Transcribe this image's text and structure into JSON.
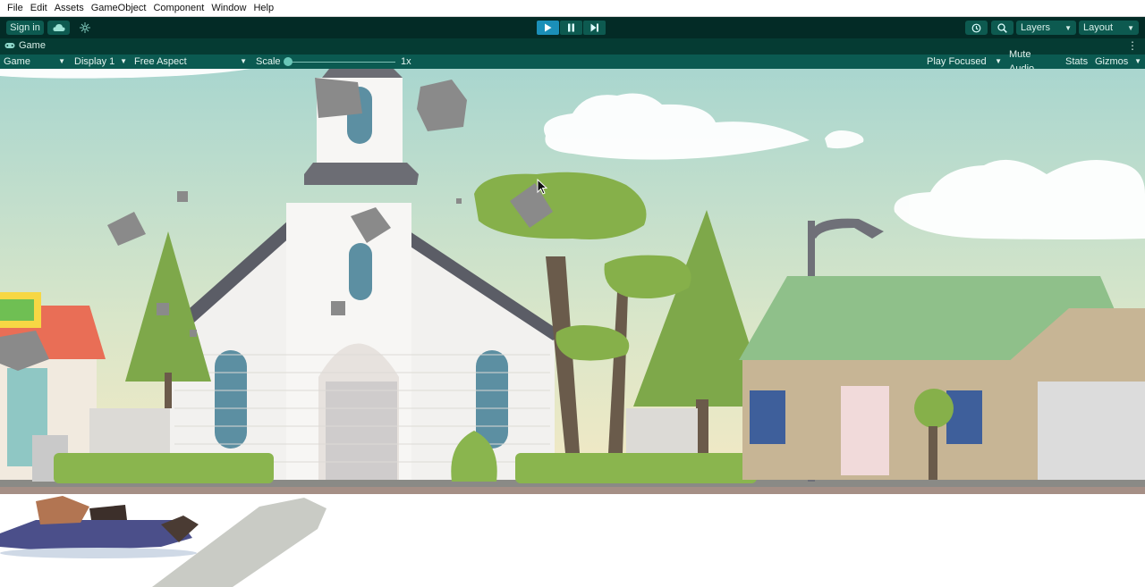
{
  "menu": [
    "File",
    "Edit",
    "Assets",
    "GameObject",
    "Component",
    "Window",
    "Help"
  ],
  "toolbar": {
    "sign_in": "Sign in",
    "cloud_icon": "cloud-icon",
    "collab_icon": "collab-icon",
    "play_icon": "play-icon",
    "pause_icon": "pause-icon",
    "step_icon": "step-icon",
    "history_icon": "history-icon",
    "search_icon": "search-icon",
    "layers": "Layers",
    "layout": "Layout"
  },
  "tab": {
    "label": "Game",
    "icon": "gamepad-icon"
  },
  "game_bar": {
    "view": "Game",
    "display": "Display 1",
    "aspect": "Free Aspect",
    "scale_label": "Scale",
    "scale_value": "1x",
    "play_focused": "Play Focused",
    "mute_audio": "Mute Audio",
    "stats": "Stats",
    "gizmos": "Gizmos"
  },
  "colors": {
    "toolbar_bg": "#032b26",
    "tabbar_bg": "#053b33",
    "ctrlbar_bg": "#0b5a51",
    "play_active": "#1b8fb8"
  }
}
